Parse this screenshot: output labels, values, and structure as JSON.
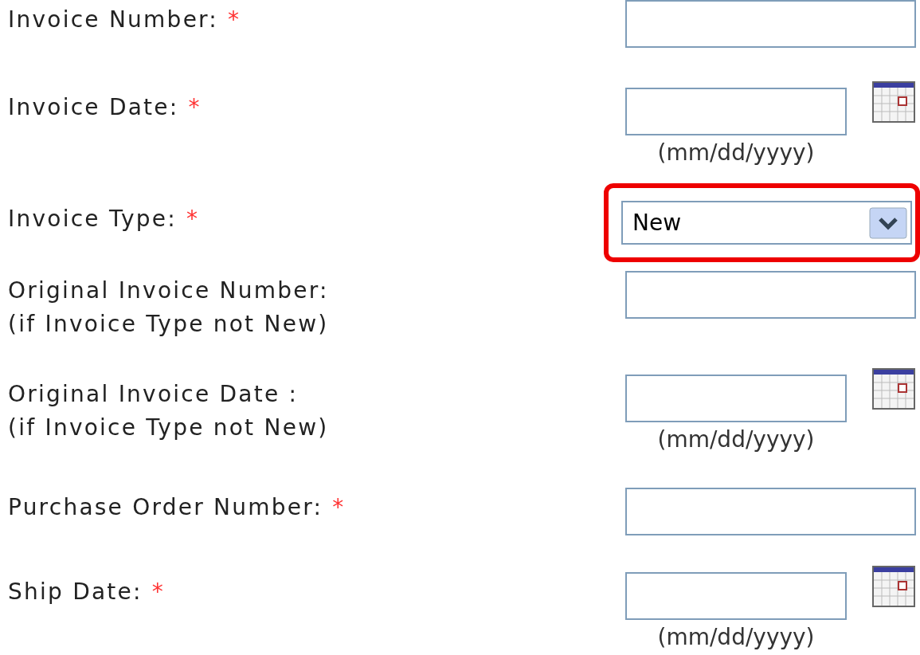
{
  "fields": [
    {
      "kind": "text",
      "label": "Invoice Number:",
      "required_mark": "*"
    },
    {
      "kind": "date",
      "label": "Invoice Date:",
      "required_mark": "*",
      "hint": "(mm/dd/yyyy)"
    },
    {
      "kind": "select",
      "label": "Invoice Type:",
      "required_mark": "*",
      "value": "New",
      "highlighted": true
    },
    {
      "kind": "text",
      "label": "Original Invoice Number:",
      "note": "(if Invoice Type not New)"
    },
    {
      "kind": "date",
      "label": "Original Invoice Date :",
      "note": "(if Invoice Type not New)",
      "hint": "(mm/dd/yyyy)"
    },
    {
      "kind": "text",
      "label": "Purchase Order Number:",
      "required_mark": "*"
    },
    {
      "kind": "date",
      "label": "Ship Date:",
      "required_mark": "*",
      "hint": "(mm/dd/yyyy)"
    }
  ]
}
